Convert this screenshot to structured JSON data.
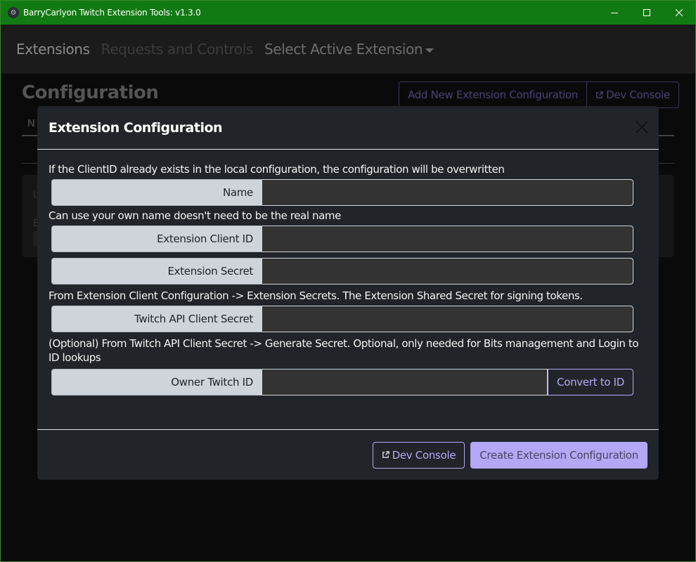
{
  "window": {
    "title": "BarryCarlyon Twitch Extension Tools: v1.3.0",
    "controls": [
      "minimize",
      "maximize",
      "close"
    ]
  },
  "navbar": {
    "items": [
      {
        "label": "Extensions",
        "state": "active"
      },
      {
        "label": "Requests and Controls",
        "state": "disabled"
      },
      {
        "label": "Select Active Extension",
        "state": "dropdown"
      }
    ]
  },
  "page": {
    "title": "Configuration",
    "buttons": {
      "add_new": "Add New Extension Configuration",
      "dev_console": "Dev Console"
    },
    "background_fragments": {
      "tab_partial": "N",
      "row1_partial": "U",
      "row2_partial": "E"
    }
  },
  "modal": {
    "title": "Extension Configuration",
    "intro": "If the ClientID already exists in the local configuration, the configuration will be overwritten",
    "fields": [
      {
        "label": "Name",
        "value": "",
        "help_after": "Can use your own name doesn't need to be the real name"
      },
      {
        "label": "Extension Client ID",
        "value": "",
        "help_after": ""
      },
      {
        "label": "Extension Secret",
        "value": "",
        "help_after": "From Extension Client Configuration -> Extension Secrets. The Extension Shared Secret for signing tokens."
      },
      {
        "label": "Twitch API Client Secret",
        "value": "",
        "help_after": "(Optional) From Twitch API Client Secret -> Generate Secret. Optional, only needed for Bits management and Login to ID lookups"
      },
      {
        "label": "Owner Twitch ID",
        "value": "",
        "button": "Convert to ID"
      }
    ],
    "footer": {
      "dev_console": "Dev Console",
      "create": "Create Extension Configuration"
    }
  },
  "colors": {
    "titlebar": "#127a12",
    "accent": "#b4a7f5",
    "modal_bg": "#212529",
    "input_bg": "#333333",
    "label_bg": "#ced4da"
  }
}
